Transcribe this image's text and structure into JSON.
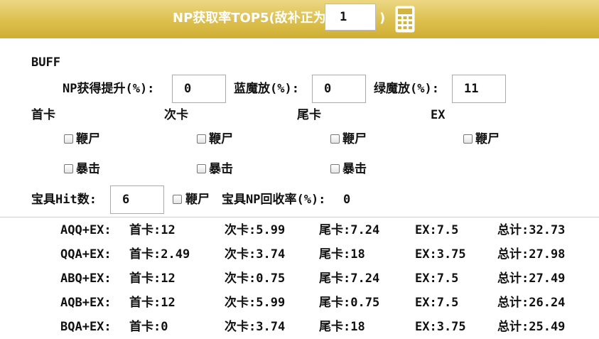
{
  "header": {
    "title": "NP获取率TOP5(敌补正为",
    "paren_close": ")",
    "enemy_correction": "1",
    "calculator_icon": "calculator-icon"
  },
  "buff": {
    "section_label": "BUFF",
    "np_gain_label": "NP获得提升(%):",
    "np_gain_value": "0",
    "blue_buff_label": "蓝魔放(%):",
    "blue_buff_value": "0",
    "green_buff_label": "绿魔放(%):",
    "green_buff_value": "11"
  },
  "cards": [
    {
      "label": "首卡",
      "overkill": "鞭尸",
      "critical": "暴击"
    },
    {
      "label": "次卡",
      "overkill": "鞭尸",
      "critical": "暴击"
    },
    {
      "label": "尾卡",
      "overkill": "鞭尸",
      "critical": "暴击"
    },
    {
      "label": "EX",
      "overkill": "鞭尸"
    }
  ],
  "noble_phantasm": {
    "hit_label": "宝具Hit数:",
    "hit_value": "6",
    "overkill_label": "鞭尸",
    "np_refund_label": "宝具NP回收率(%):",
    "np_refund_value": "0"
  },
  "results": [
    {
      "combo": "AQQ+EX:",
      "first": "首卡:12",
      "second": "次卡:5.99",
      "third": "尾卡:7.24",
      "ex": "EX:7.5",
      "total": "总计:32.73"
    },
    {
      "combo": "QQA+EX:",
      "first": "首卡:2.49",
      "second": "次卡:3.74",
      "third": "尾卡:18",
      "ex": "EX:3.75",
      "total": "总计:27.98"
    },
    {
      "combo": "ABQ+EX:",
      "first": "首卡:12",
      "second": "次卡:0.75",
      "third": "尾卡:7.24",
      "ex": "EX:7.5",
      "total": "总计:27.49"
    },
    {
      "combo": "AQB+EX:",
      "first": "首卡:12",
      "second": "次卡:5.99",
      "third": "尾卡:0.75",
      "ex": "EX:7.5",
      "total": "总计:26.24"
    },
    {
      "combo": "BQA+EX:",
      "first": "首卡:0",
      "second": "次卡:3.74",
      "third": "尾卡:18",
      "ex": "EX:3.75",
      "total": "总计:25.49"
    }
  ]
}
